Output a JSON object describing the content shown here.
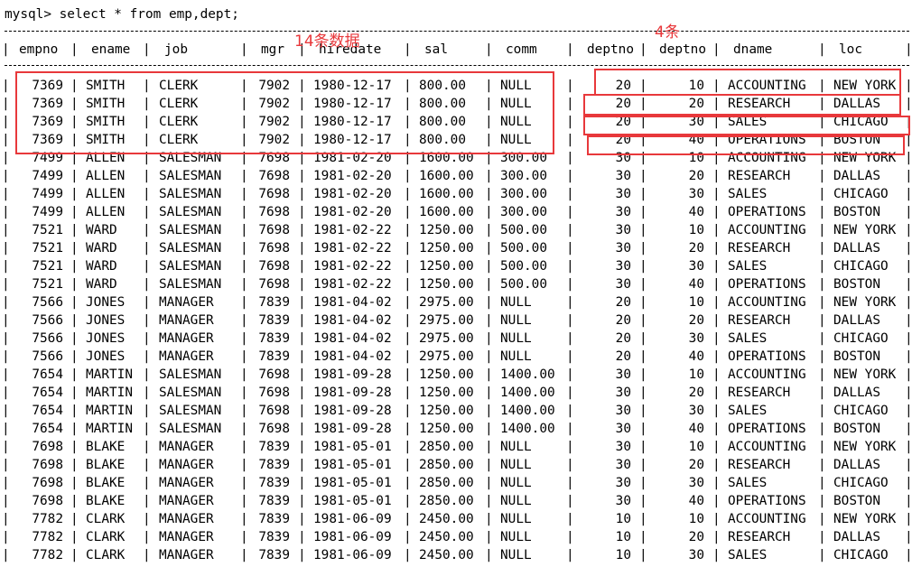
{
  "command": "mysql> select * from emp,dept;",
  "header": [
    "empno",
    "ename",
    "job",
    "mgr",
    "hiredate",
    "sal",
    "comm",
    "deptno",
    "deptno",
    "dname",
    "loc"
  ],
  "rows": [
    [
      "7369",
      "SMITH",
      "CLERK",
      "7902",
      "1980-12-17",
      "800.00",
      "NULL",
      "20",
      "10",
      "ACCOUNTING",
      "NEW YORK"
    ],
    [
      "7369",
      "SMITH",
      "CLERK",
      "7902",
      "1980-12-17",
      "800.00",
      "NULL",
      "20",
      "20",
      "RESEARCH",
      "DALLAS"
    ],
    [
      "7369",
      "SMITH",
      "CLERK",
      "7902",
      "1980-12-17",
      "800.00",
      "NULL",
      "20",
      "30",
      "SALES",
      "CHICAGO"
    ],
    [
      "7369",
      "SMITH",
      "CLERK",
      "7902",
      "1980-12-17",
      "800.00",
      "NULL",
      "20",
      "40",
      "OPERATIONS",
      "BOSTON"
    ],
    [
      "7499",
      "ALLEN",
      "SALESMAN",
      "7698",
      "1981-02-20",
      "1600.00",
      "300.00",
      "30",
      "10",
      "ACCOUNTING",
      "NEW YORK"
    ],
    [
      "7499",
      "ALLEN",
      "SALESMAN",
      "7698",
      "1981-02-20",
      "1600.00",
      "300.00",
      "30",
      "20",
      "RESEARCH",
      "DALLAS"
    ],
    [
      "7499",
      "ALLEN",
      "SALESMAN",
      "7698",
      "1981-02-20",
      "1600.00",
      "300.00",
      "30",
      "30",
      "SALES",
      "CHICAGO"
    ],
    [
      "7499",
      "ALLEN",
      "SALESMAN",
      "7698",
      "1981-02-20",
      "1600.00",
      "300.00",
      "30",
      "40",
      "OPERATIONS",
      "BOSTON"
    ],
    [
      "7521",
      "WARD",
      "SALESMAN",
      "7698",
      "1981-02-22",
      "1250.00",
      "500.00",
      "30",
      "10",
      "ACCOUNTING",
      "NEW YORK"
    ],
    [
      "7521",
      "WARD",
      "SALESMAN",
      "7698",
      "1981-02-22",
      "1250.00",
      "500.00",
      "30",
      "20",
      "RESEARCH",
      "DALLAS"
    ],
    [
      "7521",
      "WARD",
      "SALESMAN",
      "7698",
      "1981-02-22",
      "1250.00",
      "500.00",
      "30",
      "30",
      "SALES",
      "CHICAGO"
    ],
    [
      "7521",
      "WARD",
      "SALESMAN",
      "7698",
      "1981-02-22",
      "1250.00",
      "500.00",
      "30",
      "40",
      "OPERATIONS",
      "BOSTON"
    ],
    [
      "7566",
      "JONES",
      "MANAGER",
      "7839",
      "1981-04-02",
      "2975.00",
      "NULL",
      "20",
      "10",
      "ACCOUNTING",
      "NEW YORK"
    ],
    [
      "7566",
      "JONES",
      "MANAGER",
      "7839",
      "1981-04-02",
      "2975.00",
      "NULL",
      "20",
      "20",
      "RESEARCH",
      "DALLAS"
    ],
    [
      "7566",
      "JONES",
      "MANAGER",
      "7839",
      "1981-04-02",
      "2975.00",
      "NULL",
      "20",
      "30",
      "SALES",
      "CHICAGO"
    ],
    [
      "7566",
      "JONES",
      "MANAGER",
      "7839",
      "1981-04-02",
      "2975.00",
      "NULL",
      "20",
      "40",
      "OPERATIONS",
      "BOSTON"
    ],
    [
      "7654",
      "MARTIN",
      "SALESMAN",
      "7698",
      "1981-09-28",
      "1250.00",
      "1400.00",
      "30",
      "10",
      "ACCOUNTING",
      "NEW YORK"
    ],
    [
      "7654",
      "MARTIN",
      "SALESMAN",
      "7698",
      "1981-09-28",
      "1250.00",
      "1400.00",
      "30",
      "20",
      "RESEARCH",
      "DALLAS"
    ],
    [
      "7654",
      "MARTIN",
      "SALESMAN",
      "7698",
      "1981-09-28",
      "1250.00",
      "1400.00",
      "30",
      "30",
      "SALES",
      "CHICAGO"
    ],
    [
      "7654",
      "MARTIN",
      "SALESMAN",
      "7698",
      "1981-09-28",
      "1250.00",
      "1400.00",
      "30",
      "40",
      "OPERATIONS",
      "BOSTON"
    ],
    [
      "7698",
      "BLAKE",
      "MANAGER",
      "7839",
      "1981-05-01",
      "2850.00",
      "NULL",
      "30",
      "10",
      "ACCOUNTING",
      "NEW YORK"
    ],
    [
      "7698",
      "BLAKE",
      "MANAGER",
      "7839",
      "1981-05-01",
      "2850.00",
      "NULL",
      "30",
      "20",
      "RESEARCH",
      "DALLAS"
    ],
    [
      "7698",
      "BLAKE",
      "MANAGER",
      "7839",
      "1981-05-01",
      "2850.00",
      "NULL",
      "30",
      "30",
      "SALES",
      "CHICAGO"
    ],
    [
      "7698",
      "BLAKE",
      "MANAGER",
      "7839",
      "1981-05-01",
      "2850.00",
      "NULL",
      "30",
      "40",
      "OPERATIONS",
      "BOSTON"
    ],
    [
      "7782",
      "CLARK",
      "MANAGER",
      "7839",
      "1981-06-09",
      "2450.00",
      "NULL",
      "10",
      "10",
      "ACCOUNTING",
      "NEW YORK"
    ],
    [
      "7782",
      "CLARK",
      "MANAGER",
      "7839",
      "1981-06-09",
      "2450.00",
      "NULL",
      "10",
      "20",
      "RESEARCH",
      "DALLAS"
    ],
    [
      "7782",
      "CLARK",
      "MANAGER",
      "7839",
      "1981-06-09",
      "2450.00",
      "NULL",
      "10",
      "30",
      "SALES",
      "CHICAGO"
    ]
  ],
  "annotations": {
    "emp_count": "14条数据",
    "dept_count": "4条"
  },
  "colors": {
    "annotation": "#e8383b",
    "text": "#000000",
    "background": "#ffffff"
  }
}
